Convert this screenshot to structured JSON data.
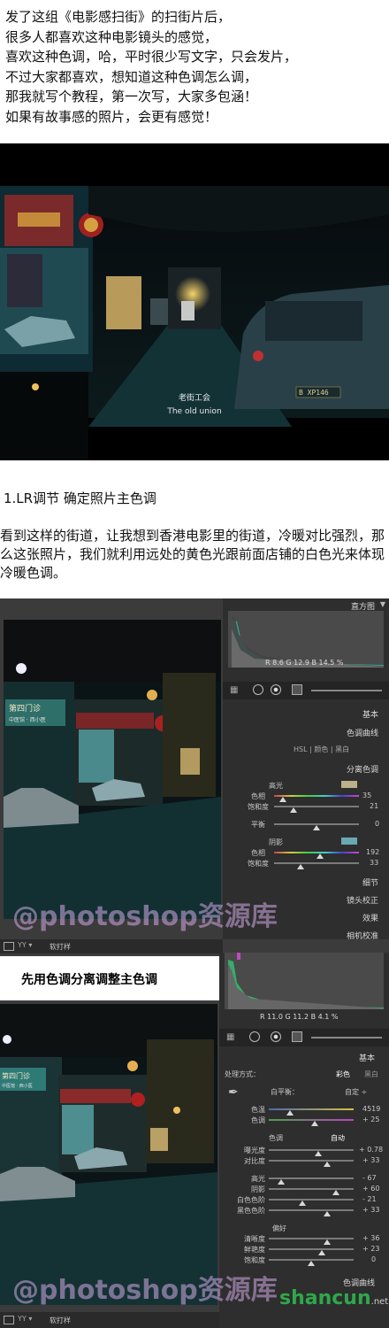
{
  "intro": {
    "lines": [
      "发了这组《电影感扫街》的扫街片后，",
      "很多人都喜欢这种电影镜头的感觉，",
      "喜欢这种色调，哈，平时很少写文字，只会发片，",
      "不过大家都喜欢，想知道这种色调怎么调，",
      "那我就写个教程，第一次写，大家多包涵！",
      "如果有故事感的照片，会更有感觉！"
    ]
  },
  "photo": {
    "subtitle_cn": "老街工会",
    "subtitle_en": "The old union",
    "plate": "B XP146"
  },
  "section1": {
    "title": "1.LR调节 确定照片主色调",
    "body": "看到这样的街道，让我想到香港电影里的街道，冷暖对比强烈，那么这张照片，我们就利用远处的黄色光跟前面店铺的白色光来体现冷暖色调。"
  },
  "lr1": {
    "histogram_label": "直方图",
    "readout": {
      "r": "8.6",
      "g": "12.9",
      "b": "14.5",
      "unit": "%"
    },
    "panels": [
      "基本",
      "色调曲线"
    ],
    "hsl_tabs": [
      "HSL",
      "颜色",
      "黑白"
    ],
    "split_title": "分离色调",
    "highlights": {
      "label": "高光",
      "hue_label": "色相",
      "hue_value": "35",
      "sat_label": "饱和度",
      "sat_value": "21"
    },
    "balance": {
      "label": "平衡",
      "value": "0"
    },
    "shadows": {
      "label": "阴影",
      "hue_label": "色相",
      "hue_value": "192",
      "sat_label": "饱和度",
      "sat_value": "33"
    },
    "more_panels": [
      "细节",
      "镜头校正",
      "效果",
      "相机校准"
    ],
    "toolbar_label": "软打样",
    "shop_sign": "第四门诊",
    "shop_sign2": "中医馆 · 西小医"
  },
  "caption": "先用色调分离调整主色调",
  "lr2": {
    "readout": {
      "r": "11.0",
      "g": "11.2",
      "b": "4.1",
      "unit": "%"
    },
    "basic_title": "基本",
    "treatment_label": "处理方式：",
    "treatment_options": [
      "彩色",
      "黑白"
    ],
    "wb_label": "白平衡：",
    "wb_value": "自定 ÷",
    "temp": {
      "label": "色温",
      "value": "4519"
    },
    "tint": {
      "label": "色调",
      "value": "+ 25"
    },
    "tone_label": "色调",
    "tone_auto": "自动",
    "exposure": {
      "label": "曝光度",
      "value": "+ 0.78"
    },
    "contrast": {
      "label": "对比度",
      "value": "+ 33"
    },
    "highlights": {
      "label": "高光",
      "value": "- 67"
    },
    "shadows": {
      "label": "阴影",
      "value": "+ 60"
    },
    "whites": {
      "label": "白色色阶",
      "value": "- 21"
    },
    "blacks": {
      "label": "黑色色阶",
      "value": "+ 33"
    },
    "presence_label": "偏好",
    "clarity": {
      "label": "清晰度",
      "value": "+ 36"
    },
    "vibrance": {
      "label": "鲜艳度",
      "value": "+ 23"
    },
    "saturation": {
      "label": "饱和度",
      "value": "0"
    },
    "curve_label": "色调曲线",
    "toolbar_label": "软打样",
    "shop_sign": "第四门诊",
    "shop_sign2": "中医馆 · 西小医"
  },
  "watermark": "@photoshop资源库",
  "site_logo": "shancun",
  "site_logo_suffix": ".net"
}
